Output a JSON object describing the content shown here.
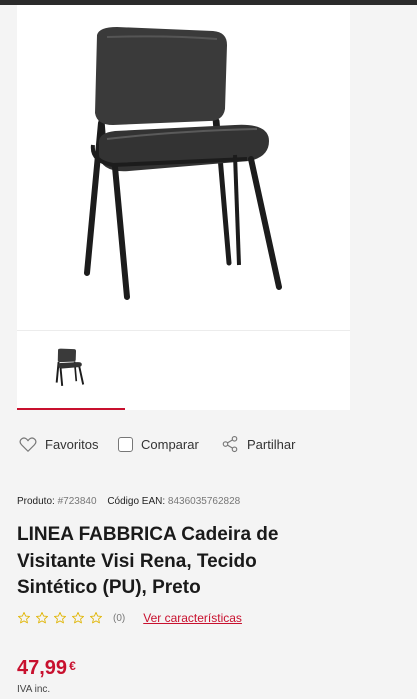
{
  "product": {
    "code_label": "Produto:",
    "code_value": "#723840",
    "ean_label": "Código EAN:",
    "ean_value": "8436035762828",
    "title": "LINEA FABBRICA Cadeira de Visitante Visi Rena, Tecido Sintético (PU), Preto",
    "rating": 0,
    "review_count": "(0)",
    "features_link": "Ver características",
    "price": "47,99",
    "currency": "€",
    "vat_note": "IVA inc."
  },
  "actions": {
    "favorites": "Favoritos",
    "compare": "Comparar",
    "share": "Partilhar"
  },
  "icons": {
    "favorites": "heart-icon",
    "compare": "checkbox",
    "share": "share-icon",
    "rating": "star-outline-icon"
  },
  "colors": {
    "accent": "#c8102e",
    "star": "#e0b400"
  }
}
